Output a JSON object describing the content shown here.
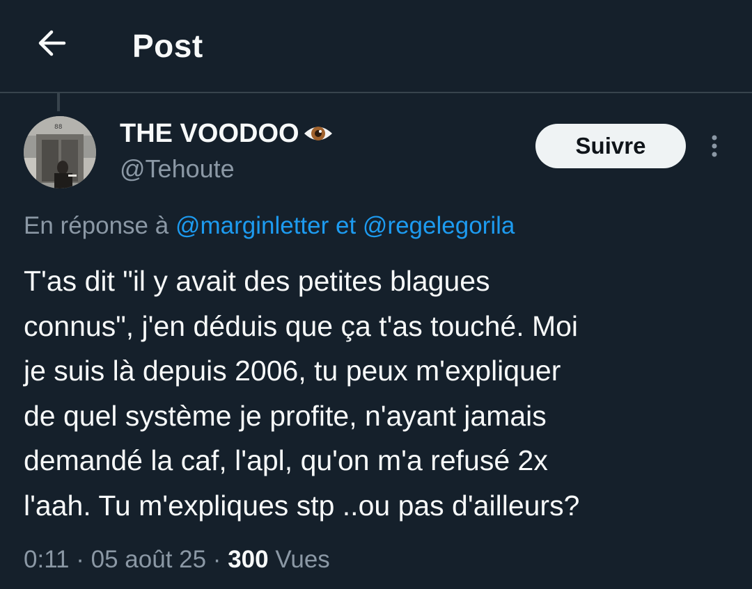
{
  "header": {
    "title": "Post",
    "back_icon": "arrow-left-icon"
  },
  "author": {
    "display_name": "THE VOODOO",
    "name_emoji": "eye-icon",
    "handle": "@Tehoute"
  },
  "actions": {
    "follow_label": "Suivre",
    "more_icon": "more-vertical-icon"
  },
  "reply_context": {
    "prefix": "En réponse à ",
    "mention_1": "@marginletter",
    "joiner": " et ",
    "mention_2": "@regelegorila"
  },
  "tweet": {
    "lines": [
      "T'as dit \"il y avait des petites blagues",
      "connus\", j'en déduis que ça t'as touché. Moi",
      "je suis là depuis 2006, tu peux m'expliquer",
      "de quel système je profite, n'ayant jamais",
      "demandé la caf, l'apl, qu'on m'a refusé 2x",
      "l'aah. Tu m'expliques stp ..ou pas d'ailleurs?"
    ]
  },
  "meta": {
    "time": "0:11",
    "separator": " · ",
    "date": "05 août 25",
    "views_count": "300",
    "views_label": " Vues"
  },
  "colors": {
    "background": "#15202b",
    "text": "#f7f9f9",
    "secondary": "#8b98a5",
    "link": "#1d9bf0",
    "divider": "#38444d"
  }
}
